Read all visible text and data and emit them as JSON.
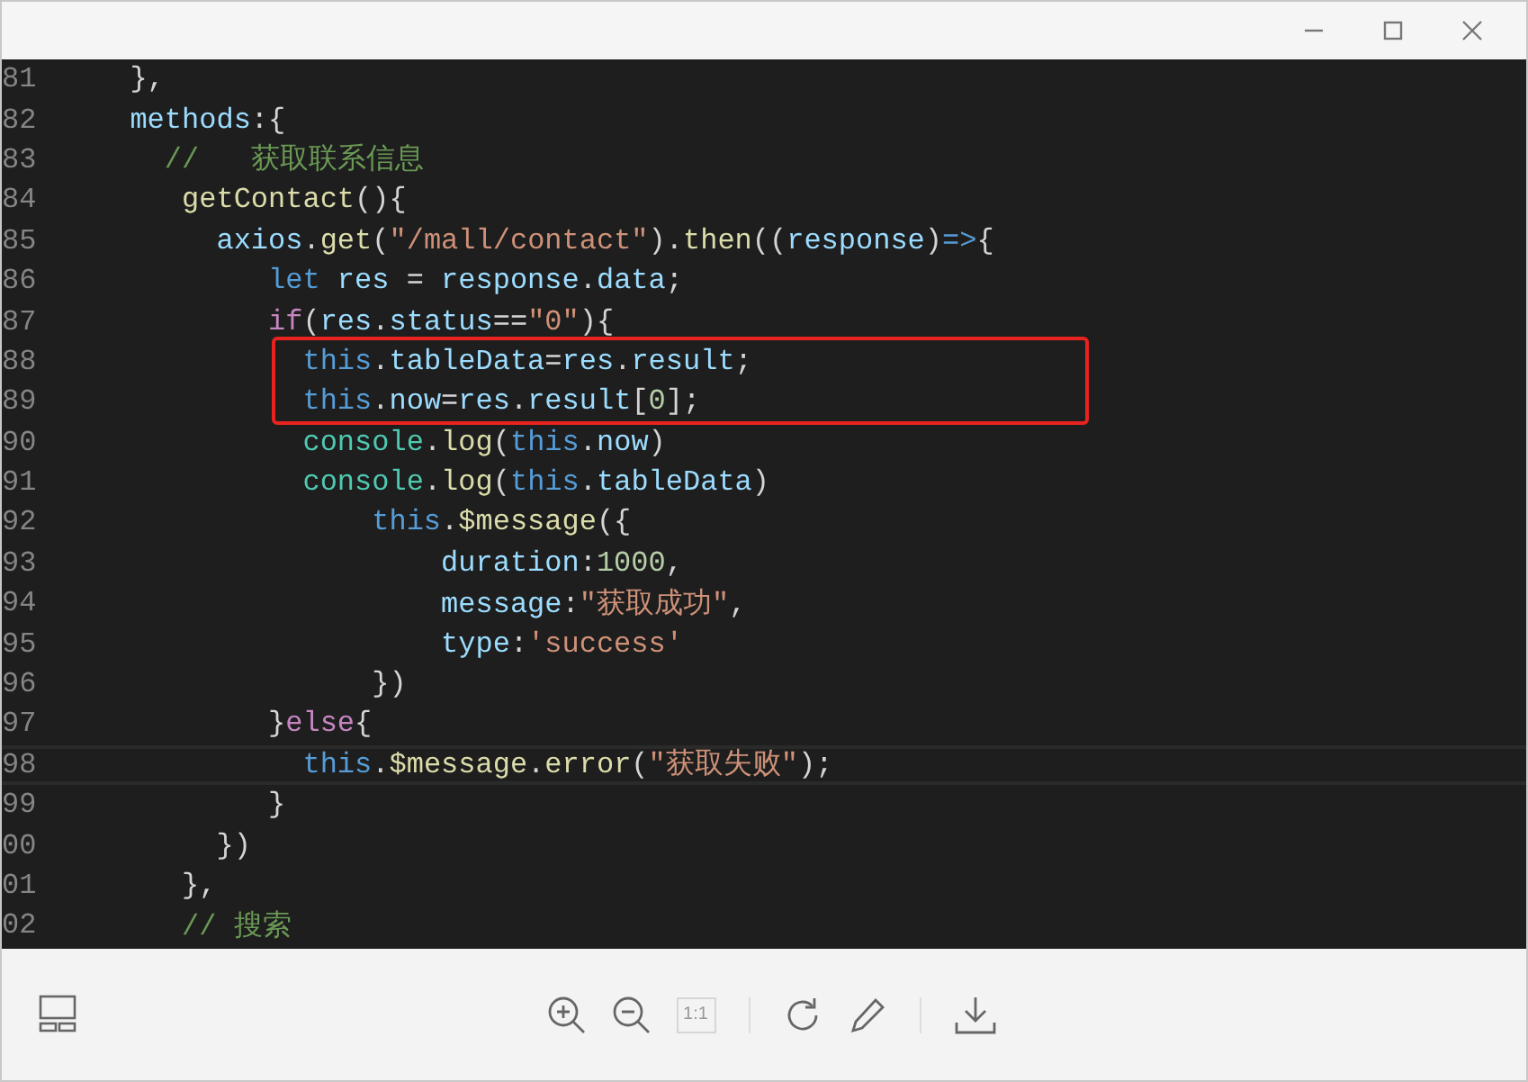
{
  "code": {
    "lines": [
      {
        "number": "81",
        "current": false,
        "marked": false,
        "tokens": [
          {
            "kind": "plain",
            "text": "  },"
          }
        ]
      },
      {
        "number": "82",
        "current": false,
        "marked": false,
        "tokens": [
          {
            "kind": "prop",
            "text": "  methods"
          },
          {
            "kind": "plain",
            "text": ":{"
          }
        ]
      },
      {
        "number": "83",
        "current": false,
        "marked": false,
        "tokens": [
          {
            "kind": "comment",
            "text": "    //   获取联系信息"
          }
        ]
      },
      {
        "number": "84",
        "current": false,
        "marked": false,
        "tokens": [
          {
            "kind": "func",
            "text": "     getContact"
          },
          {
            "kind": "plain",
            "text": "(){"
          }
        ]
      },
      {
        "number": "85",
        "current": false,
        "marked": false,
        "tokens": [
          {
            "kind": "prop",
            "text": "       axios"
          },
          {
            "kind": "plain",
            "text": "."
          },
          {
            "kind": "func",
            "text": "get"
          },
          {
            "kind": "plain",
            "text": "("
          },
          {
            "kind": "string",
            "text": "\"/mall/contact\""
          },
          {
            "kind": "plain",
            "text": ")."
          },
          {
            "kind": "func",
            "text": "then"
          },
          {
            "kind": "plain",
            "text": "(("
          },
          {
            "kind": "prop",
            "text": "response"
          },
          {
            "kind": "plain",
            "text": ")"
          },
          {
            "kind": "keyword",
            "text": "=>"
          },
          {
            "kind": "plain",
            "text": "{"
          }
        ]
      },
      {
        "number": "86",
        "current": false,
        "marked": false,
        "tokens": [
          {
            "kind": "keyword",
            "text": "          let"
          },
          {
            "kind": "prop",
            "text": " res"
          },
          {
            "kind": "plain",
            "text": " = "
          },
          {
            "kind": "prop",
            "text": "response"
          },
          {
            "kind": "plain",
            "text": "."
          },
          {
            "kind": "prop",
            "text": "data"
          },
          {
            "kind": "plain",
            "text": ";"
          }
        ]
      },
      {
        "number": "87",
        "current": false,
        "marked": false,
        "tokens": [
          {
            "kind": "control",
            "text": "          if"
          },
          {
            "kind": "plain",
            "text": "("
          },
          {
            "kind": "prop",
            "text": "res"
          },
          {
            "kind": "plain",
            "text": "."
          },
          {
            "kind": "prop",
            "text": "status"
          },
          {
            "kind": "plain",
            "text": "=="
          },
          {
            "kind": "string",
            "text": "\"0\""
          },
          {
            "kind": "plain",
            "text": "){"
          }
        ]
      },
      {
        "number": "88",
        "current": false,
        "marked": true,
        "tokens": [
          {
            "kind": "keyword",
            "text": "            this"
          },
          {
            "kind": "plain",
            "text": "."
          },
          {
            "kind": "prop",
            "text": "tableData"
          },
          {
            "kind": "plain",
            "text": "="
          },
          {
            "kind": "prop",
            "text": "res"
          },
          {
            "kind": "plain",
            "text": "."
          },
          {
            "kind": "prop",
            "text": "result"
          },
          {
            "kind": "plain",
            "text": ";"
          }
        ]
      },
      {
        "number": "89",
        "current": false,
        "marked": true,
        "tokens": [
          {
            "kind": "keyword",
            "text": "            this"
          },
          {
            "kind": "plain",
            "text": "."
          },
          {
            "kind": "prop",
            "text": "now"
          },
          {
            "kind": "plain",
            "text": "="
          },
          {
            "kind": "prop",
            "text": "res"
          },
          {
            "kind": "plain",
            "text": "."
          },
          {
            "kind": "prop",
            "text": "result"
          },
          {
            "kind": "plain",
            "text": "["
          },
          {
            "kind": "number",
            "text": "0"
          },
          {
            "kind": "plain",
            "text": "];"
          }
        ]
      },
      {
        "number": "90",
        "current": false,
        "marked": false,
        "tokens": [
          {
            "kind": "class",
            "text": "            console"
          },
          {
            "kind": "plain",
            "text": "."
          },
          {
            "kind": "func",
            "text": "log"
          },
          {
            "kind": "plain",
            "text": "("
          },
          {
            "kind": "keyword",
            "text": "this"
          },
          {
            "kind": "plain",
            "text": "."
          },
          {
            "kind": "prop",
            "text": "now"
          },
          {
            "kind": "plain",
            "text": ")"
          }
        ]
      },
      {
        "number": "91",
        "current": false,
        "marked": false,
        "tokens": [
          {
            "kind": "class",
            "text": "            console"
          },
          {
            "kind": "plain",
            "text": "."
          },
          {
            "kind": "func",
            "text": "log"
          },
          {
            "kind": "plain",
            "text": "("
          },
          {
            "kind": "keyword",
            "text": "this"
          },
          {
            "kind": "plain",
            "text": "."
          },
          {
            "kind": "prop",
            "text": "tableData"
          },
          {
            "kind": "plain",
            "text": ")"
          }
        ]
      },
      {
        "number": "92",
        "current": false,
        "marked": false,
        "tokens": [
          {
            "kind": "keyword",
            "text": "                this"
          },
          {
            "kind": "plain",
            "text": "."
          },
          {
            "kind": "func",
            "text": "$message"
          },
          {
            "kind": "plain",
            "text": "({"
          }
        ]
      },
      {
        "number": "93",
        "current": false,
        "marked": false,
        "tokens": [
          {
            "kind": "prop",
            "text": "                    duration"
          },
          {
            "kind": "plain",
            "text": ":"
          },
          {
            "kind": "number",
            "text": "1000"
          },
          {
            "kind": "plain",
            "text": ","
          }
        ]
      },
      {
        "number": "94",
        "current": false,
        "marked": false,
        "tokens": [
          {
            "kind": "prop",
            "text": "                    message"
          },
          {
            "kind": "plain",
            "text": ":"
          },
          {
            "kind": "string",
            "text": "\"获取成功\""
          },
          {
            "kind": "plain",
            "text": ","
          }
        ]
      },
      {
        "number": "95",
        "current": false,
        "marked": false,
        "tokens": [
          {
            "kind": "prop",
            "text": "                    type"
          },
          {
            "kind": "plain",
            "text": ":"
          },
          {
            "kind": "string",
            "text": "'success'"
          }
        ]
      },
      {
        "number": "96",
        "current": false,
        "marked": false,
        "tokens": [
          {
            "kind": "plain",
            "text": "                })"
          }
        ]
      },
      {
        "number": "97",
        "current": false,
        "marked": false,
        "tokens": [
          {
            "kind": "plain",
            "text": "          }"
          },
          {
            "kind": "control",
            "text": "else"
          },
          {
            "kind": "plain",
            "text": "{"
          }
        ]
      },
      {
        "number": "98",
        "current": true,
        "marked": false,
        "tokens": [
          {
            "kind": "keyword",
            "text": "            this"
          },
          {
            "kind": "plain",
            "text": "."
          },
          {
            "kind": "func",
            "text": "$message"
          },
          {
            "kind": "plain",
            "text": "."
          },
          {
            "kind": "func",
            "text": "error"
          },
          {
            "kind": "plain",
            "text": "("
          },
          {
            "kind": "string",
            "text": "\"获取失败\""
          },
          {
            "kind": "plain",
            "text": ");"
          }
        ]
      },
      {
        "number": "99",
        "current": false,
        "marked": false,
        "tokens": [
          {
            "kind": "plain",
            "text": "          }"
          }
        ]
      },
      {
        "number": "00",
        "current": false,
        "marked": false,
        "tokens": [
          {
            "kind": "plain",
            "text": "       })"
          }
        ]
      },
      {
        "number": "01",
        "current": false,
        "marked": false,
        "tokens": [
          {
            "kind": "plain",
            "text": "     },"
          }
        ]
      },
      {
        "number": "02",
        "current": false,
        "marked": false,
        "tokens": [
          {
            "kind": "comment",
            "text": "     // 搜索"
          }
        ]
      }
    ]
  },
  "toolbar": {
    "actual_size": {
      "label": "1:1",
      "disabled": true
    }
  }
}
